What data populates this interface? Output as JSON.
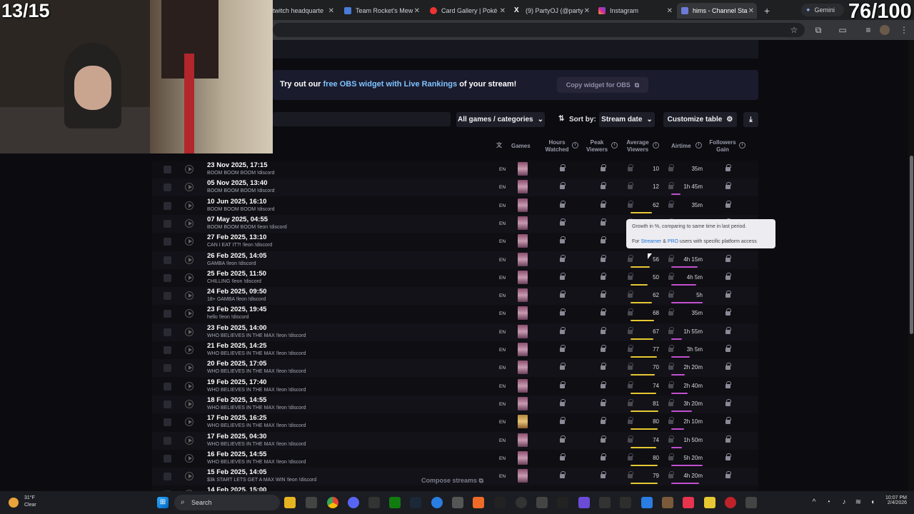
{
  "browser": {
    "tabs": [
      {
        "label": "twitch headquarte",
        "active": false
      },
      {
        "label": "Team Rocket's Mew",
        "active": false
      },
      {
        "label": "Card Gallery | Poké",
        "active": false
      },
      {
        "label": "(9) PartyOJ (@party",
        "active": false
      },
      {
        "label": "Instagram",
        "active": false
      },
      {
        "label": "hims - Channel Sta",
        "active": true
      }
    ],
    "gemini_label": "Gemini",
    "new_tab": "+"
  },
  "overlay": {
    "left_counter": "13/15",
    "right_counter": "76/100"
  },
  "banner": {
    "prefix": "Try out our ",
    "link": "free OBS widget with Live Rankings",
    "suffix": " of your stream!",
    "copy_button": "Copy widget for OBS"
  },
  "controls": {
    "games_filter": "All games / categories",
    "sort_by_label": "Sort by:",
    "sort_value": "Stream date",
    "customize": "Customize table"
  },
  "columns": {
    "games": "Games",
    "hours_watched": [
      "Hours",
      "Watched"
    ],
    "peak_viewers": [
      "Peak",
      "Viewers"
    ],
    "average_viewers": [
      "Average",
      "Viewers"
    ],
    "airtime": "Airtime",
    "followers_gain": [
      "Followers",
      "Gain"
    ]
  },
  "tooltip": {
    "line1": "Growth in %, comparing to same time in last period.",
    "pre": "For ",
    "streamer": "Streamer",
    "amp": " & ",
    "pro": "PRO",
    "post": " users with specific platform access"
  },
  "rows": [
    {
      "date": "23 Nov 2025, 17:15",
      "title": "BOOM BOOM BOOM !discord",
      "lang": "EN",
      "avg": "10",
      "avg_pct": 0,
      "air": "35m",
      "air_pct": 0
    },
    {
      "date": "05 Nov 2025, 13:40",
      "title": "BOOM BOOM BOOM !discord",
      "lang": "EN",
      "avg": "12",
      "avg_pct": 0,
      "air": "1h 45m",
      "air_pct": 0.3
    },
    {
      "date": "10 Jun 2025, 16:10",
      "title": "BOOM BOOM BOOM !discord",
      "lang": "EN",
      "avg": "62",
      "avg_pct": 0.74,
      "air": "35m",
      "air_pct": 0
    },
    {
      "date": "07 May 2025, 04:55",
      "title": "BOOM BOOM BOOM !leon !discord",
      "lang": "EN",
      "avg": "",
      "avg_pct": 0,
      "air": "",
      "air_pct": 0
    },
    {
      "date": "27 Feb 2025, 13:10",
      "title": "CAN I EAT IT?! !leon !discord",
      "lang": "EN",
      "avg": "",
      "avg_pct": 0,
      "air": "",
      "air_pct": 0
    },
    {
      "date": "26 Feb 2025, 14:05",
      "title": "GAMBA !leon !discord",
      "lang": "EN",
      "avg": "56",
      "avg_pct": 0.68,
      "air": "4h 15m",
      "air_pct": 0.85
    },
    {
      "date": "25 Feb 2025, 11:50",
      "title": "CHILLING !leon !discord",
      "lang": "EN",
      "avg": "50",
      "avg_pct": 0.6,
      "air": "4h 5m",
      "air_pct": 0.8
    },
    {
      "date": "24 Feb 2025, 09:50",
      "title": "18+ GAMBA !leon !discord",
      "lang": "EN",
      "avg": "62",
      "avg_pct": 0.74,
      "air": "5h",
      "air_pct": 1.0
    },
    {
      "date": "23 Feb 2025, 19:45",
      "title": "hello !leon !discord",
      "lang": "EN",
      "avg": "68",
      "avg_pct": 0.82,
      "air": "35m",
      "air_pct": 0
    },
    {
      "date": "23 Feb 2025, 14:00",
      "title": "WHO BELIEVES IN THE MAX !leon !discord",
      "lang": "EN",
      "avg": "67",
      "avg_pct": 0.8,
      "air": "1h 55m",
      "air_pct": 0.34
    },
    {
      "date": "21 Feb 2025, 14:25",
      "title": "WHO BELIEVES IN THE MAX !leon !discord",
      "lang": "EN",
      "avg": "77",
      "avg_pct": 0.92,
      "air": "3h 5m",
      "air_pct": 0.6
    },
    {
      "date": "20 Feb 2025, 17:05",
      "title": "WHO BELIEVES IN THE MAX !leon !discord",
      "lang": "EN",
      "avg": "70",
      "avg_pct": 0.85,
      "air": "2h 20m",
      "air_pct": 0.44
    },
    {
      "date": "19 Feb 2025, 17:40",
      "title": "WHO BELIEVES IN THE MAX !leon !discord",
      "lang": "EN",
      "avg": "74",
      "avg_pct": 0.9,
      "air": "2h 40m",
      "air_pct": 0.52
    },
    {
      "date": "18 Feb 2025, 14:55",
      "title": "WHO BELIEVES IN THE MAX !leon !discord",
      "lang": "EN",
      "avg": "81",
      "avg_pct": 0.97,
      "air": "3h 20m",
      "air_pct": 0.65
    },
    {
      "date": "17 Feb 2025, 16:25",
      "title": "WHO BELIEVES IN THE MAX !leon !discord",
      "lang": "EN",
      "avg": "80",
      "avg_pct": 0.96,
      "air": "2h 10m",
      "air_pct": 0.42
    },
    {
      "date": "17 Feb 2025, 04:30",
      "title": "WHO BELIEVES IN THE MAX !leon !discord",
      "lang": "EN",
      "avg": "74",
      "avg_pct": 0.9,
      "air": "1h 50m",
      "air_pct": 0.33
    },
    {
      "date": "16 Feb 2025, 14:55",
      "title": "WHO BELIEVES IN THE MAX !leon !discord",
      "lang": "EN",
      "avg": "80",
      "avg_pct": 0.96,
      "air": "5h 20m",
      "air_pct": 1.0
    },
    {
      "date": "15 Feb 2025, 14:05",
      "title": "$3k START LETS GET A MAX WIN !leon !discord",
      "lang": "EN",
      "avg": "79",
      "avg_pct": 0.95,
      "air": "4h 20m",
      "air_pct": 0.88
    },
    {
      "date": "14 Feb 2025, 15:00",
      "title": "",
      "lang": "",
      "avg": "",
      "avg_pct": 0,
      "air": "",
      "air_pct": 0
    }
  ],
  "compose": "Compose streams",
  "taskbar": {
    "weather_temp": "31°F",
    "weather_text": "Clear",
    "search": "Search",
    "time": "10:07 PM",
    "date": "2/4/2026"
  }
}
